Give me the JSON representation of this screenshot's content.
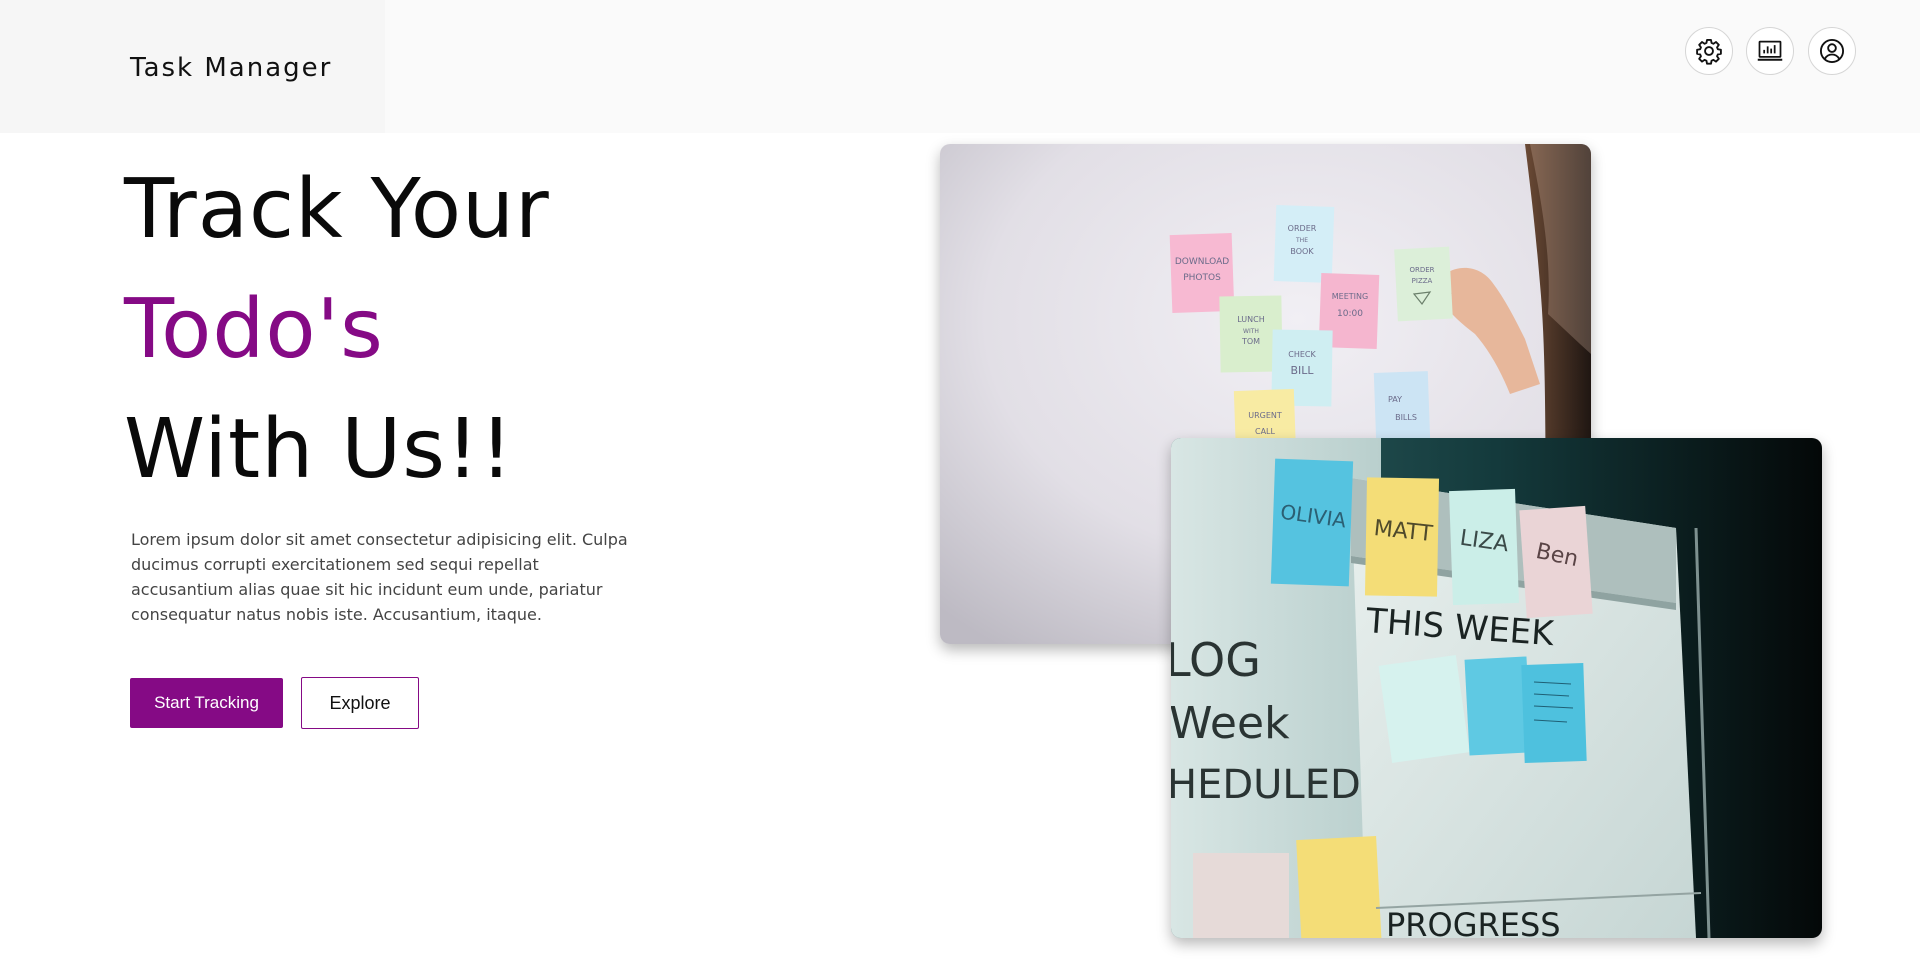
{
  "header": {
    "brand": "Task Manager",
    "icons": [
      "gear-icon",
      "bar-chart-icon",
      "user-circle-icon"
    ]
  },
  "hero": {
    "line1": "Track Your",
    "line2": "Todo's",
    "line3": "With Us!!",
    "description": "Lorem ipsum dolor sit amet consectetur adipisicing elit. Culpa ducimus corrupti exercitationem sed sequi repellat accusantium alias quae sit hic incidunt eum unde, pariatur consequatur natus nobis iste. Accusantium, itaque.",
    "primary_button": "Start Tracking",
    "secondary_button": "Explore"
  },
  "photos": {
    "sticky_notes": {
      "note1": "DOWNLOAD",
      "note1b": "PHOTOS",
      "note2": "ORDER",
      "note2b": "THE",
      "note2c": "BOOK",
      "note3": "ORDER",
      "note3b": "PIZZA",
      "note4": "LUNCH",
      "note4b": "WITH",
      "note4c": "TOM",
      "note5": "MEETING",
      "note5b": "10:00",
      "note6": "CHECK",
      "note6b": "BILL",
      "note7": "PAY",
      "note7b": "BILLS",
      "note8": "URGENT",
      "note8b": "CALL"
    },
    "whiteboard": {
      "name1": "OLIVIA",
      "name2": "MATT",
      "name3": "LIZA",
      "name4": "Ben",
      "heading": "THIS WEEK",
      "left1": "LOG",
      "left2": "Week",
      "left3": "HEDULED",
      "bottom": "PROGRESS"
    }
  },
  "colors": {
    "accent": "#850a85",
    "topbar": "#fafafa"
  }
}
